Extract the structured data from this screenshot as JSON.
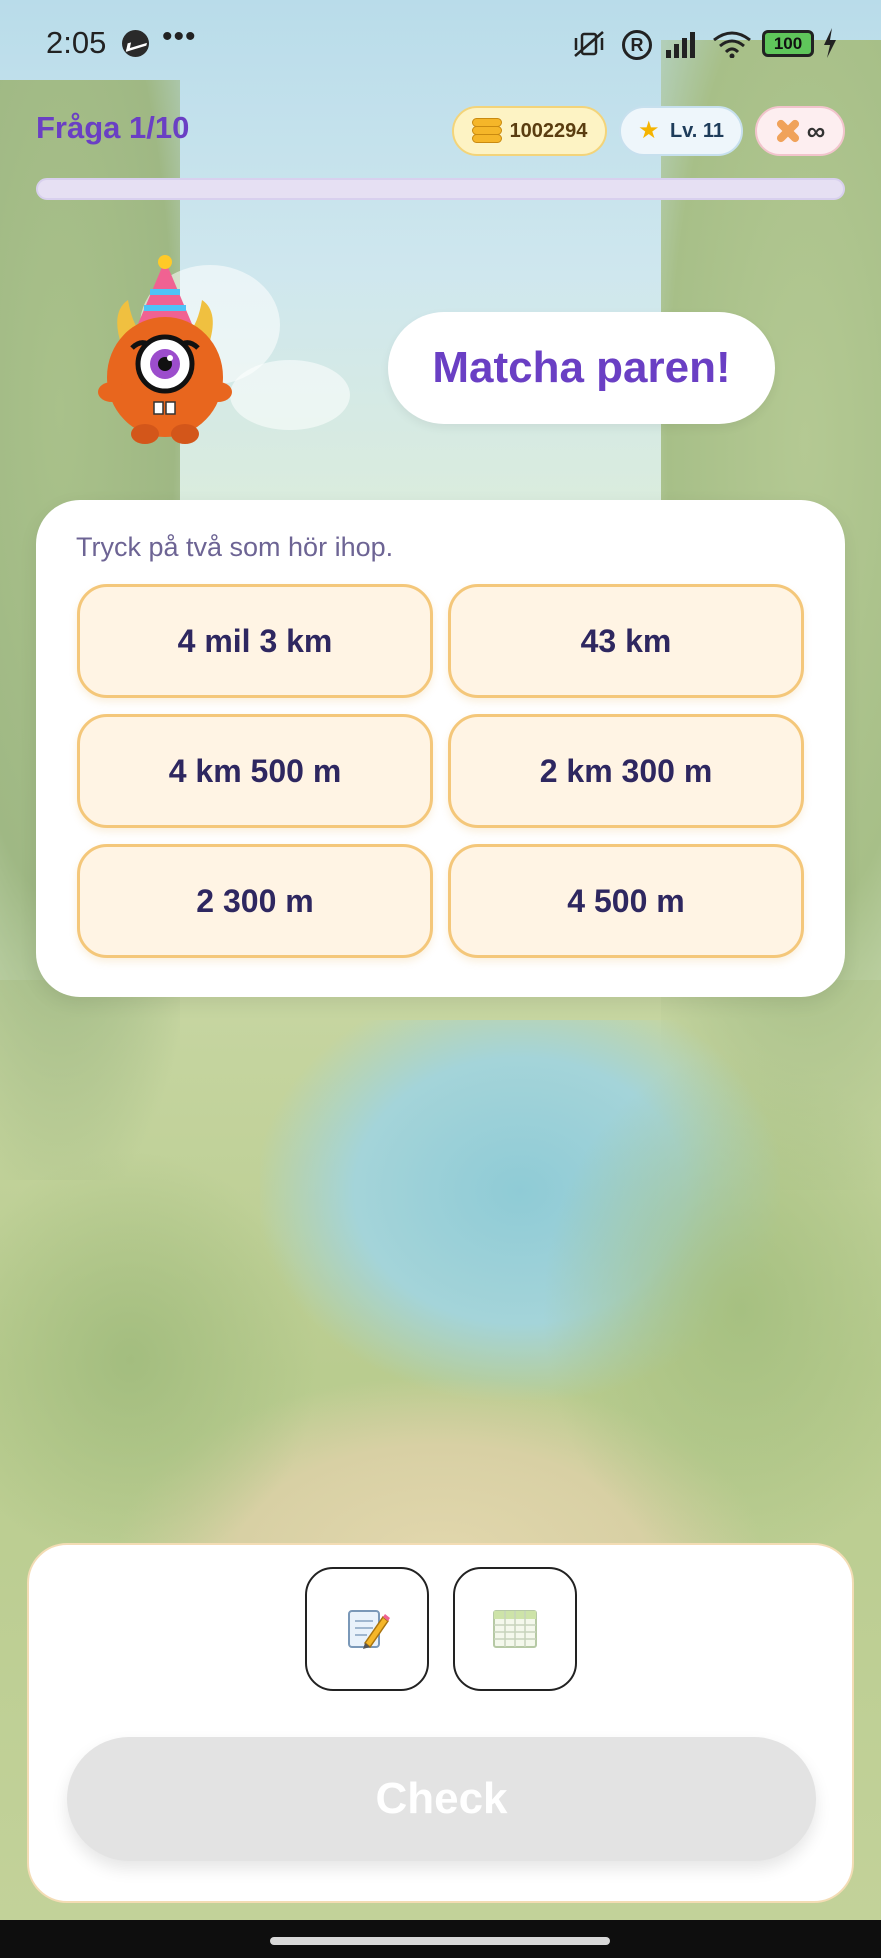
{
  "status_bar": {
    "time": "2:05",
    "dots": "•••",
    "registered": "R",
    "battery": "100"
  },
  "header": {
    "question_label": "Fråga 1/10",
    "coins": "1002294",
    "level": "Lv. 11",
    "lives": "∞",
    "progress_fraction": 0
  },
  "speech_bubble": {
    "text": "Matcha paren!"
  },
  "card": {
    "instruction": "Tryck på två som hör ihop.",
    "tiles": [
      "4 mil 3 km",
      "43 km",
      "4 km 500 m",
      "2 km 300 m",
      "2 300 m",
      "4 500 m"
    ]
  },
  "bottom": {
    "tools": [
      {
        "icon": "notepad-pencil-icon"
      },
      {
        "icon": "table-icon"
      }
    ],
    "check_label": "Check"
  },
  "colors": {
    "accent_purple": "#6a3fc4",
    "tile_border": "#f4c77a",
    "tile_bg": "#fff4e4",
    "check_disabled": "#e3e3e3"
  }
}
